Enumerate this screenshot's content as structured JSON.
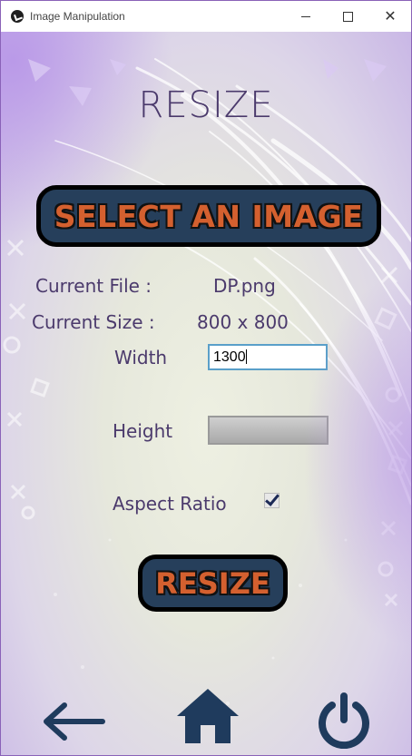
{
  "window": {
    "title": "Image Manipulation",
    "minimize_icon": "minimize-icon",
    "maximize_icon": "maximize-icon",
    "close_glyph": "✕"
  },
  "page": {
    "heading": "RESIZE",
    "select_button": "SELECT AN IMAGE",
    "current_file_label": "Current File :",
    "current_file_value": "DP.png",
    "current_size_label": "Current Size :",
    "current_size_value": "800 x 800",
    "width_label": "Width",
    "width_value": "1300",
    "height_label": "Height",
    "height_value": "",
    "aspect_ratio_label": "Aspect Ratio",
    "aspect_ratio_checked": true,
    "resize_button": "RESIZE"
  },
  "bottom_nav": {
    "items": [
      {
        "name": "back",
        "icon": "arrow-left-icon"
      },
      {
        "name": "home",
        "icon": "home-icon"
      },
      {
        "name": "power",
        "icon": "power-icon"
      }
    ]
  },
  "colors": {
    "heading_text": "#4b3a6c",
    "button_bg": "#263f5b",
    "button_text": "#d4602f",
    "nav_icon": "#1f3b5d"
  }
}
